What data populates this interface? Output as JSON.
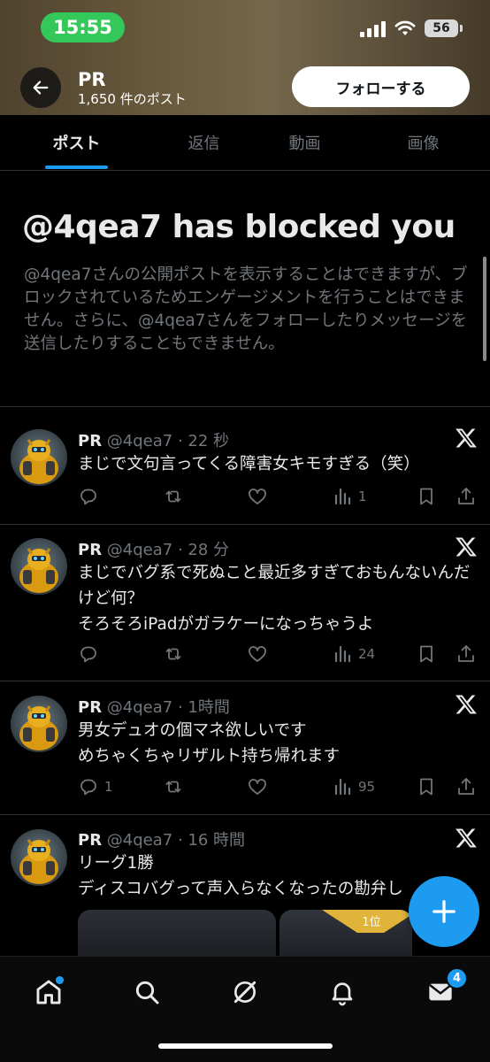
{
  "status_bar": {
    "time": "15:55",
    "battery": "56"
  },
  "profile": {
    "name": "PR",
    "post_count": "1,650 件のポスト",
    "follow_label": "フォローする"
  },
  "tabs": [
    {
      "label": "ポスト",
      "active": true
    },
    {
      "label": "返信",
      "active": false
    },
    {
      "label": "動画",
      "active": false
    },
    {
      "label": "画像",
      "active": false
    }
  ],
  "blocked": {
    "title": "@4qea7 has blocked you",
    "body": "@4qea7さんの公開ポストを表示することはできますが、ブロックされているためエンゲージメントを行うことはできません。さらに、@4qea7さんをフォローしたりメッセージを送信したりすることもできません。"
  },
  "posts": [
    {
      "name": "PR",
      "handle": "@4qea7",
      "time": "22 秒",
      "text": "まじで文句言ってくる障害女キモすぎる（笑）",
      "replies": "",
      "views": "1"
    },
    {
      "name": "PR",
      "handle": "@4qea7",
      "time": "28 分",
      "text": "まじでバグ系で死ぬこと最近多すぎておもんないんだけど何？\nそろそろiPadがガラケーになっちゃうよ",
      "replies": "",
      "views": "24"
    },
    {
      "name": "PR",
      "handle": "@4qea7",
      "time": "1時間",
      "text": "男女デュオの個マネ欲しいです\nめちゃくちゃリザルト持ち帰れます",
      "replies": "1",
      "views": "95"
    },
    {
      "name": "PR",
      "handle": "@4qea7",
      "time": "16 時間",
      "text": "リーグ1勝\nディスコバグって声入らなくなったの勘弁し",
      "replies": "",
      "views": ""
    }
  ],
  "media_badge": "1位",
  "nav": {
    "messages_badge": "4"
  },
  "colors": {
    "accent": "#1d9bf0",
    "status_green": "#34c759",
    "muted": "#71767b",
    "divider": "#2f3336"
  }
}
